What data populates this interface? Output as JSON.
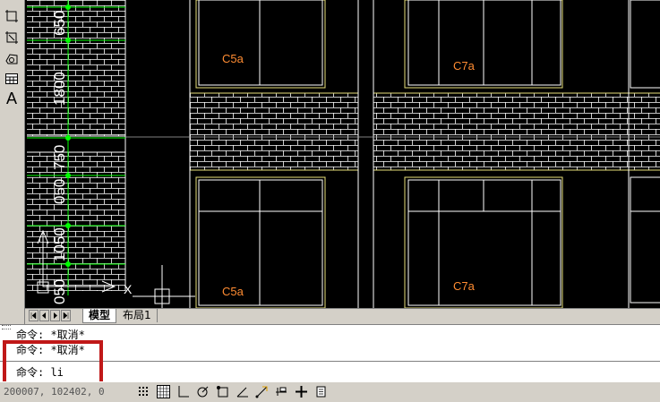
{
  "toolbar_icons": [
    "region-icon",
    "table-insert-icon",
    "boundary-icon",
    "table-icon",
    "text-icon"
  ],
  "text_tool_glyph": "A",
  "drawing": {
    "dimension_labels": [
      "650",
      "1800",
      "750",
      "050",
      "1050",
      "650",
      "050"
    ],
    "window_tags": [
      "C5a",
      "C7a",
      "C5a",
      "C7a"
    ],
    "colors": {
      "background": "#000000",
      "brick": "#ffffff",
      "window_outline": "#e8e07a",
      "dimension_line": "#00ff00",
      "tag_text": "#ff8c32"
    }
  },
  "tabs": {
    "nav_icons": [
      "first-tab-icon",
      "prev-tab-icon",
      "next-tab-icon",
      "last-tab-icon"
    ],
    "items": [
      {
        "label": "模型",
        "active": true
      },
      {
        "label": "布局1",
        "active": false
      }
    ]
  },
  "command_history": [
    "命令: *取消*",
    "命令: *取消*"
  ],
  "command_prompt": "命令: li",
  "status": {
    "coordinates": "200007, 102402, 0",
    "buttons": [
      "snap-icon",
      "grid-icon",
      "ortho-icon",
      "polar-icon",
      "osnap-icon",
      "otrack-icon",
      "ducs-icon",
      "dyn-icon",
      "lwt-icon",
      "model-icon"
    ]
  }
}
